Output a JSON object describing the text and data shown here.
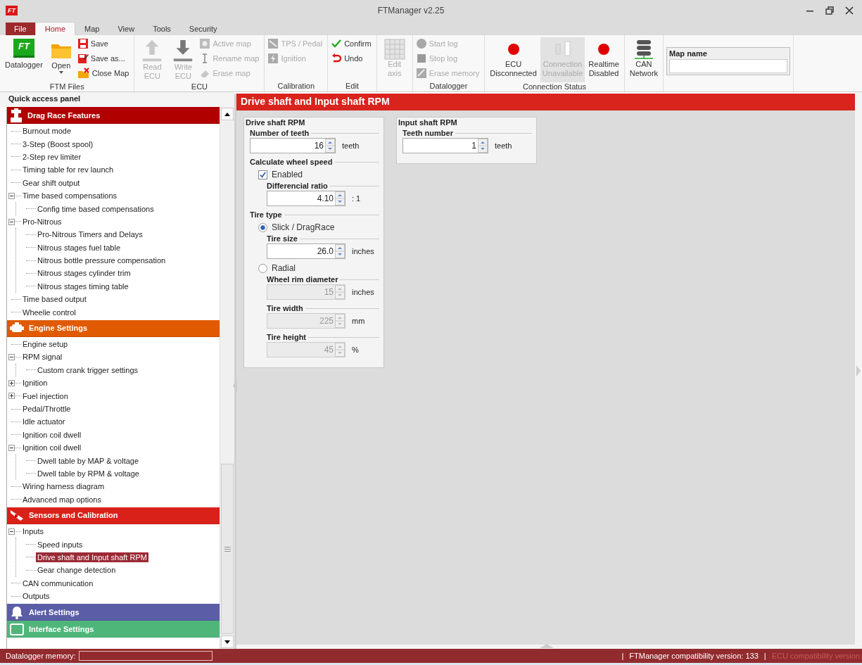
{
  "window": {
    "logo": "FT",
    "title": "FTManager v2.25"
  },
  "tabs": [
    {
      "label": "File",
      "kind": "menu",
      "selected": false
    },
    {
      "label": "Home",
      "kind": "tab",
      "selected": true
    },
    {
      "label": "Map",
      "kind": "tab",
      "selected": false
    },
    {
      "label": "View",
      "kind": "tab",
      "selected": false
    },
    {
      "label": "Tools",
      "kind": "tab",
      "selected": false
    },
    {
      "label": "Security",
      "kind": "tab",
      "selected": false
    }
  ],
  "ribbon": [
    {
      "label": "FTM Files",
      "items": [
        {
          "kind": "large",
          "label": "Datalogger",
          "badge": "FT",
          "disabled": false
        },
        {
          "kind": "large",
          "label": "Open",
          "dropdown": true,
          "disabled": false
        },
        {
          "kind": "small",
          "label": "Save",
          "disabled": false
        },
        {
          "kind": "small",
          "label": "Save as...",
          "disabled": false
        },
        {
          "kind": "small",
          "label": "Close Map",
          "disabled": false
        }
      ]
    },
    {
      "label": "ECU",
      "items": [
        {
          "kind": "large",
          "label": "Read\nECU",
          "disabled": true
        },
        {
          "kind": "large",
          "label": "Write\nECU",
          "disabled": true
        },
        {
          "kind": "small",
          "label": "Active map",
          "disabled": true
        },
        {
          "kind": "small",
          "label": "Rename map",
          "disabled": true
        },
        {
          "kind": "small",
          "label": "Erase map",
          "disabled": true
        }
      ]
    },
    {
      "label": "Calibration",
      "items": [
        {
          "kind": "small",
          "label": "TPS / Pedal",
          "disabled": true
        },
        {
          "kind": "small",
          "label": "Ignition",
          "disabled": true
        }
      ]
    },
    {
      "label": "Edit",
      "items": [
        {
          "kind": "small",
          "label": "Confirm",
          "disabled": false
        },
        {
          "kind": "small",
          "label": "Undo",
          "disabled": false
        }
      ]
    },
    {
      "items": [
        {
          "kind": "large",
          "label": "Edit\naxis",
          "disabled": true
        }
      ]
    },
    {
      "label": "Datalogger",
      "items": [
        {
          "kind": "small",
          "label": "Start log",
          "disabled": true
        },
        {
          "kind": "small",
          "label": "Stop log",
          "disabled": true
        },
        {
          "kind": "small",
          "label": "Erase memory",
          "disabled": true
        }
      ]
    },
    {
      "label": "Connection Status",
      "items": [
        {
          "kind": "large",
          "label": "ECU\nDisconnected",
          "disabled": false
        },
        {
          "kind": "large",
          "label": "Connection\nUnavailable",
          "disabled": true,
          "highlighted": true
        },
        {
          "kind": "large",
          "label": "Realtime\nDisabled",
          "disabled": false
        }
      ]
    },
    {
      "items": [
        {
          "kind": "large",
          "label": "CAN\nNetwork",
          "disabled": false
        }
      ]
    },
    {
      "items": [
        {
          "kind": "field",
          "label": "Map name"
        }
      ]
    }
  ],
  "sidebar": {
    "title": "Quick access panel",
    "sections": [
      {
        "title": "Drag Race Features",
        "color": "#b00000",
        "items": [
          {
            "label": "Burnout mode",
            "selected": false
          },
          {
            "label": "3-Step (Boost spool)",
            "selected": false
          },
          {
            "label": "2-Step rev limiter",
            "selected": false
          },
          {
            "label": "Timing table for rev launch",
            "selected": false
          },
          {
            "label": "Gear shift output",
            "selected": false
          },
          {
            "label": "Time based compensations",
            "selected": false,
            "expanded": true,
            "children": [
              {
                "label": "Config time based compensations",
                "selected": false
              }
            ]
          },
          {
            "label": "Pro-Nitrous",
            "selected": false,
            "expanded": true,
            "children": [
              {
                "label": "Pro-Nitrous Timers and Delays",
                "selected": false
              },
              {
                "label": "Nitrous stages fuel table",
                "selected": false
              },
              {
                "label": "Nitrous bottle pressure compensation",
                "selected": false
              },
              {
                "label": "Nitrous stages cylinder trim",
                "selected": false
              },
              {
                "label": "Nitrous stages timing table",
                "selected": false
              }
            ]
          },
          {
            "label": "Time based output",
            "selected": false
          },
          {
            "label": "Wheelie control",
            "selected": false
          }
        ]
      },
      {
        "title": "Engine Settings",
        "color": "#df5a00",
        "items": [
          {
            "label": "Engine setup",
            "selected": false
          },
          {
            "label": "RPM signal",
            "selected": false,
            "expanded": true,
            "children": [
              {
                "label": "Custom crank trigger settings",
                "selected": false
              }
            ]
          },
          {
            "label": "Ignition",
            "selected": false,
            "expanded": false
          },
          {
            "label": "Fuel injection",
            "selected": false,
            "expanded": false
          },
          {
            "label": "Pedal/Throttle",
            "selected": false
          },
          {
            "label": "Idle actuator",
            "selected": false
          },
          {
            "label": "Ignition coil dwell",
            "selected": false
          },
          {
            "label": "Ignition coil dwell",
            "selected": false,
            "expanded": true,
            "children": [
              {
                "label": "Dwell table by MAP & voltage",
                "selected": false
              },
              {
                "label": "Dwell table by RPM & voltage",
                "selected": false
              }
            ]
          },
          {
            "label": "Wiring harness diagram",
            "selected": false
          },
          {
            "label": "Advanced map options",
            "selected": false
          }
        ]
      },
      {
        "title": "Sensors and Calibration",
        "color": "#d92119",
        "items": [
          {
            "label": "Inputs",
            "selected": false,
            "expanded": true,
            "children": [
              {
                "label": "Speed inputs",
                "selected": false
              },
              {
                "label": "Drive shaft and Input shaft RPM",
                "selected": true
              },
              {
                "label": "Gear change detection",
                "selected": false
              }
            ]
          },
          {
            "label": "CAN communication",
            "selected": false
          },
          {
            "label": "Outputs",
            "selected": false
          }
        ]
      },
      {
        "title": "Alert Settings",
        "color": "#5b5ea6"
      },
      {
        "title": "Interface Settings",
        "color": "#4fb67a"
      }
    ]
  },
  "main": {
    "title": "Drive shaft and Input shaft RPM",
    "panels": [
      {
        "title": "Drive shaft RPM",
        "children": [
          {
            "kind": "field",
            "label": "Number of teeth",
            "value": "16",
            "unit": "teeth",
            "disabled": false
          },
          {
            "kind": "section",
            "label": "Calculate wheel speed",
            "children": [
              {
                "kind": "checkbox",
                "label": "Enabled",
                "checked": true,
                "children": [
                  {
                    "kind": "field",
                    "label": "Differencial ratio",
                    "value": "4.10",
                    "unit": ": 1",
                    "disabled": false
                  }
                ]
              }
            ]
          },
          {
            "kind": "section",
            "label": "Tire type",
            "children": [
              {
                "kind": "radio",
                "label": "Slick / DragRace",
                "selected": true,
                "children": [
                  {
                    "kind": "field",
                    "label": "Tire size",
                    "value": "26.0",
                    "unit": "inches",
                    "disabled": false
                  }
                ]
              },
              {
                "kind": "radio",
                "label": "Radial",
                "selected": false,
                "children": [
                  {
                    "kind": "field",
                    "label": "Wheel rim diameter",
                    "value": "15",
                    "unit": "inches",
                    "disabled": true
                  },
                  {
                    "kind": "field",
                    "label": "Tire width",
                    "value": "225",
                    "unit": "mm",
                    "disabled": true
                  },
                  {
                    "kind": "field",
                    "label": "Tire height",
                    "value": "45",
                    "unit": "%",
                    "disabled": true
                  }
                ]
              }
            ]
          }
        ]
      },
      {
        "title": "Input shaft RPM",
        "children": [
          {
            "kind": "field",
            "label": "Teeth number",
            "value": "1",
            "unit": "teeth",
            "disabled": false
          }
        ]
      }
    ]
  },
  "status_bar": {
    "memory_label": "Datalogger memory:",
    "memory": {
      "level": 0
    },
    "items": [
      {
        "kind": "separator",
        "text": "|"
      },
      {
        "kind": "text",
        "text": "FTManager compatibility version: 133",
        "disabled": false
      },
      {
        "kind": "separator",
        "text": "|"
      },
      {
        "kind": "text",
        "text": "ECU compatibility version:",
        "disabled": true
      }
    ]
  }
}
